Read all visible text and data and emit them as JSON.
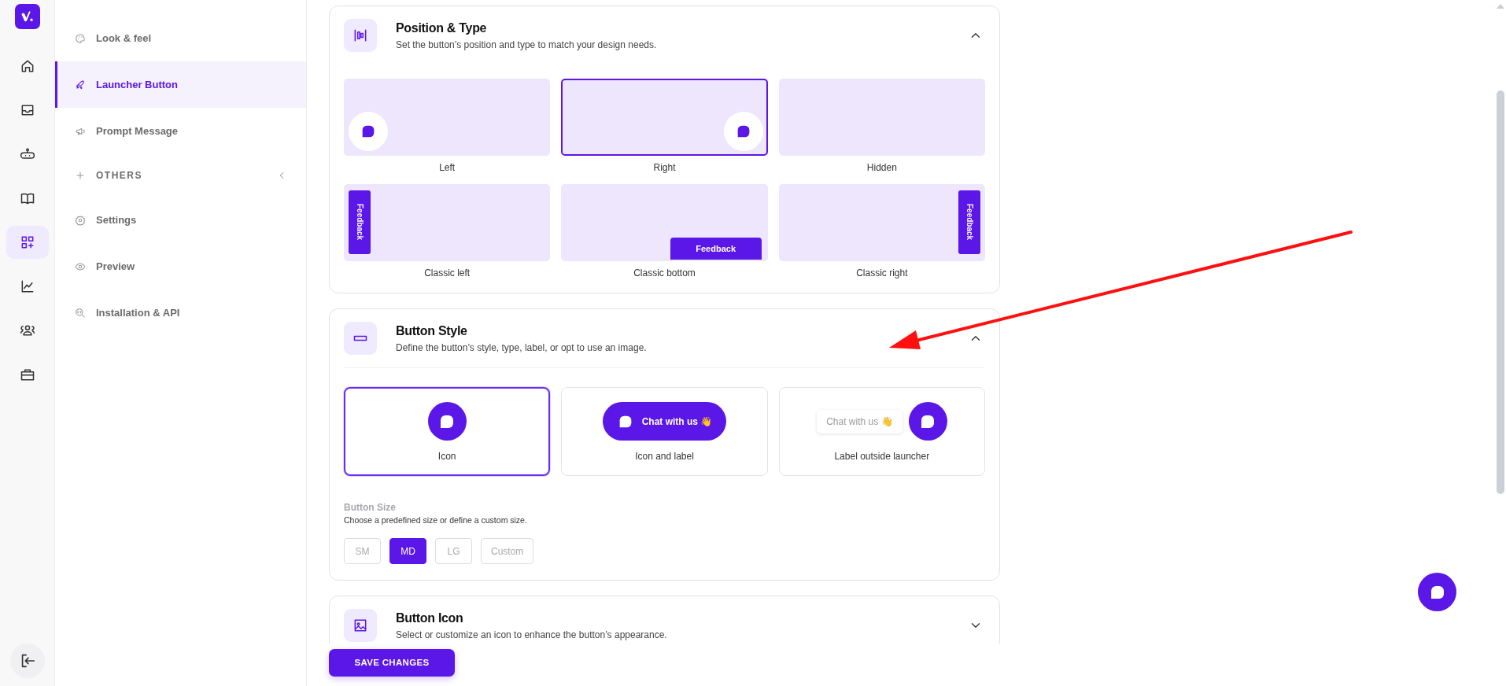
{
  "rail": {
    "items": [
      {
        "selected": false
      },
      {
        "selected": false
      },
      {
        "selected": false
      },
      {
        "selected": false
      },
      {
        "selected": true
      },
      {
        "selected": false
      },
      {
        "selected": false
      },
      {
        "selected": false
      }
    ]
  },
  "sidebar": {
    "items": [
      {
        "kind": "link",
        "label": "Look & feel",
        "selected": false
      },
      {
        "kind": "link",
        "label": "Launcher Button",
        "selected": true
      },
      {
        "kind": "link",
        "label": "Prompt Message",
        "selected": false
      },
      {
        "kind": "group",
        "label": "OTHERS",
        "expanded": false
      },
      {
        "kind": "link",
        "label": "Settings",
        "selected": false
      },
      {
        "kind": "link",
        "label": "Preview",
        "selected": false
      },
      {
        "kind": "link",
        "label": "Installation & API",
        "selected": false
      }
    ]
  },
  "sections": [
    {
      "kind": "position",
      "title": "Position & Type",
      "description": "Set the button’s position and type to match your design needs.",
      "expanded": true,
      "options": [
        {
          "label": "Left",
          "kind": "bubble-left",
          "selected": false
        },
        {
          "label": "Right",
          "kind": "bubble-right",
          "selected": true
        },
        {
          "label": "Hidden",
          "kind": "none",
          "selected": false
        },
        {
          "label": "Classic left",
          "kind": "tab-left",
          "tab_label": "Feedback",
          "selected": false
        },
        {
          "label": "Classic bottom",
          "kind": "tab-bottom",
          "tab_label": "Feedback",
          "selected": false
        },
        {
          "label": "Classic right",
          "kind": "tab-right",
          "tab_label": "Feedback",
          "selected": false
        }
      ]
    },
    {
      "kind": "style",
      "title": "Button Style",
      "description": "Define the button’s style, type, label, or opt to use an image.",
      "expanded": true,
      "options": [
        {
          "label": "Icon",
          "kind": "icon",
          "selected": true
        },
        {
          "label": "Icon and label",
          "kind": "icon-label",
          "chip_label": "Chat with us 👋",
          "selected": false
        },
        {
          "label": "Label outside launcher",
          "kind": "label-outside",
          "chip_label": "Chat with us 👋",
          "selected": false
        }
      ],
      "size": {
        "title": "Button Size",
        "hint": "Choose a predefined size or define a custom size.",
        "options": [
          {
            "label": "SM",
            "selected": false
          },
          {
            "label": "MD",
            "selected": true
          },
          {
            "label": "LG",
            "selected": false
          },
          {
            "label": "Custom",
            "selected": false
          }
        ]
      }
    },
    {
      "kind": "icon",
      "title": "Button Icon",
      "description": "Select or customize an icon to enhance the button’s appearance.",
      "expanded": false
    }
  ],
  "save_button": {
    "label": "SAVE CHANGES"
  }
}
